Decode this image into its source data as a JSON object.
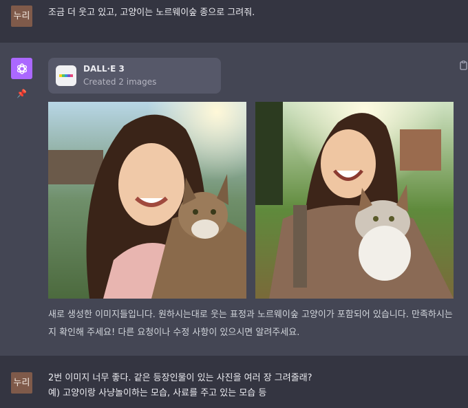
{
  "conversation": {
    "user_avatar_label": "누리",
    "first_user_message": "조금 더 웃고 있고, 고양이는 노르웨이숲 종으로 그려줘.",
    "assistant": {
      "tool_card": {
        "title": "DALL·E 3",
        "subtitle": "Created 2 images"
      },
      "images": [
        {
          "icon": "generated-image-1"
        },
        {
          "icon": "generated-image-2"
        }
      ],
      "reply_text": "새로 생성한 이미지들입니다. 원하시는대로 웃는 표정과 노르웨이숲 고양이가 포함되어 있습니다. 만족하시는지 확인해 주세요! 다른 요청이나 수정 사항이 있으시면 알려주세요."
    },
    "second_user_message_line1": "2번 이미지 너무 좋다. 같은 등장인물이 있는 사진을 여러 장 그려줄래?",
    "second_user_message_line2": "예) 고양이랑 사냥놀이하는 모습, 사료를 주고 있는 모습 등"
  },
  "colors": {
    "background_user": "#343541",
    "background_assistant": "#444654",
    "gpt_avatar": "#ab68ff",
    "user_avatar": "#7f5a4a"
  }
}
